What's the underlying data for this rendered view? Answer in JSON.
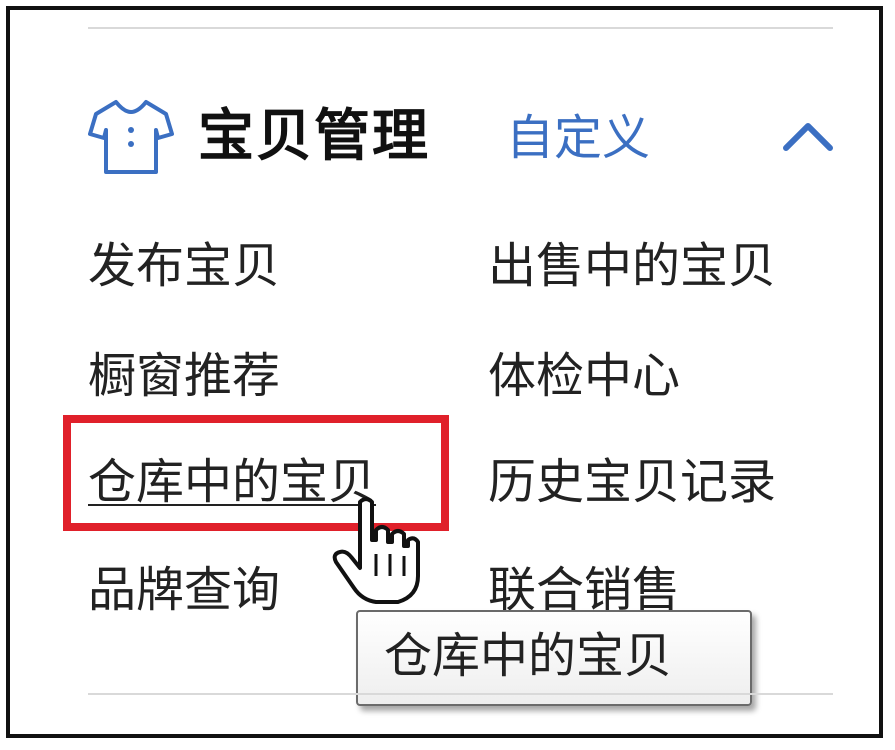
{
  "panel": {
    "title": "宝贝管理",
    "customize_label": "自定义",
    "shirt_icon": "shirt-icon",
    "collapse_icon": "chevron-up-icon",
    "accent_color": "#3b6fc2",
    "highlight_color": "#e0202a"
  },
  "links": {
    "publish": "发布宝贝",
    "on_sale": "出售中的宝贝",
    "window_recommend": "橱窗推荐",
    "health_check": "体检中心",
    "in_warehouse": "仓库中的宝贝",
    "history": "历史宝贝记录",
    "brand_query": "品牌查询",
    "joint_sales": "联合销售"
  },
  "tooltip": {
    "text": "仓库中的宝贝"
  }
}
